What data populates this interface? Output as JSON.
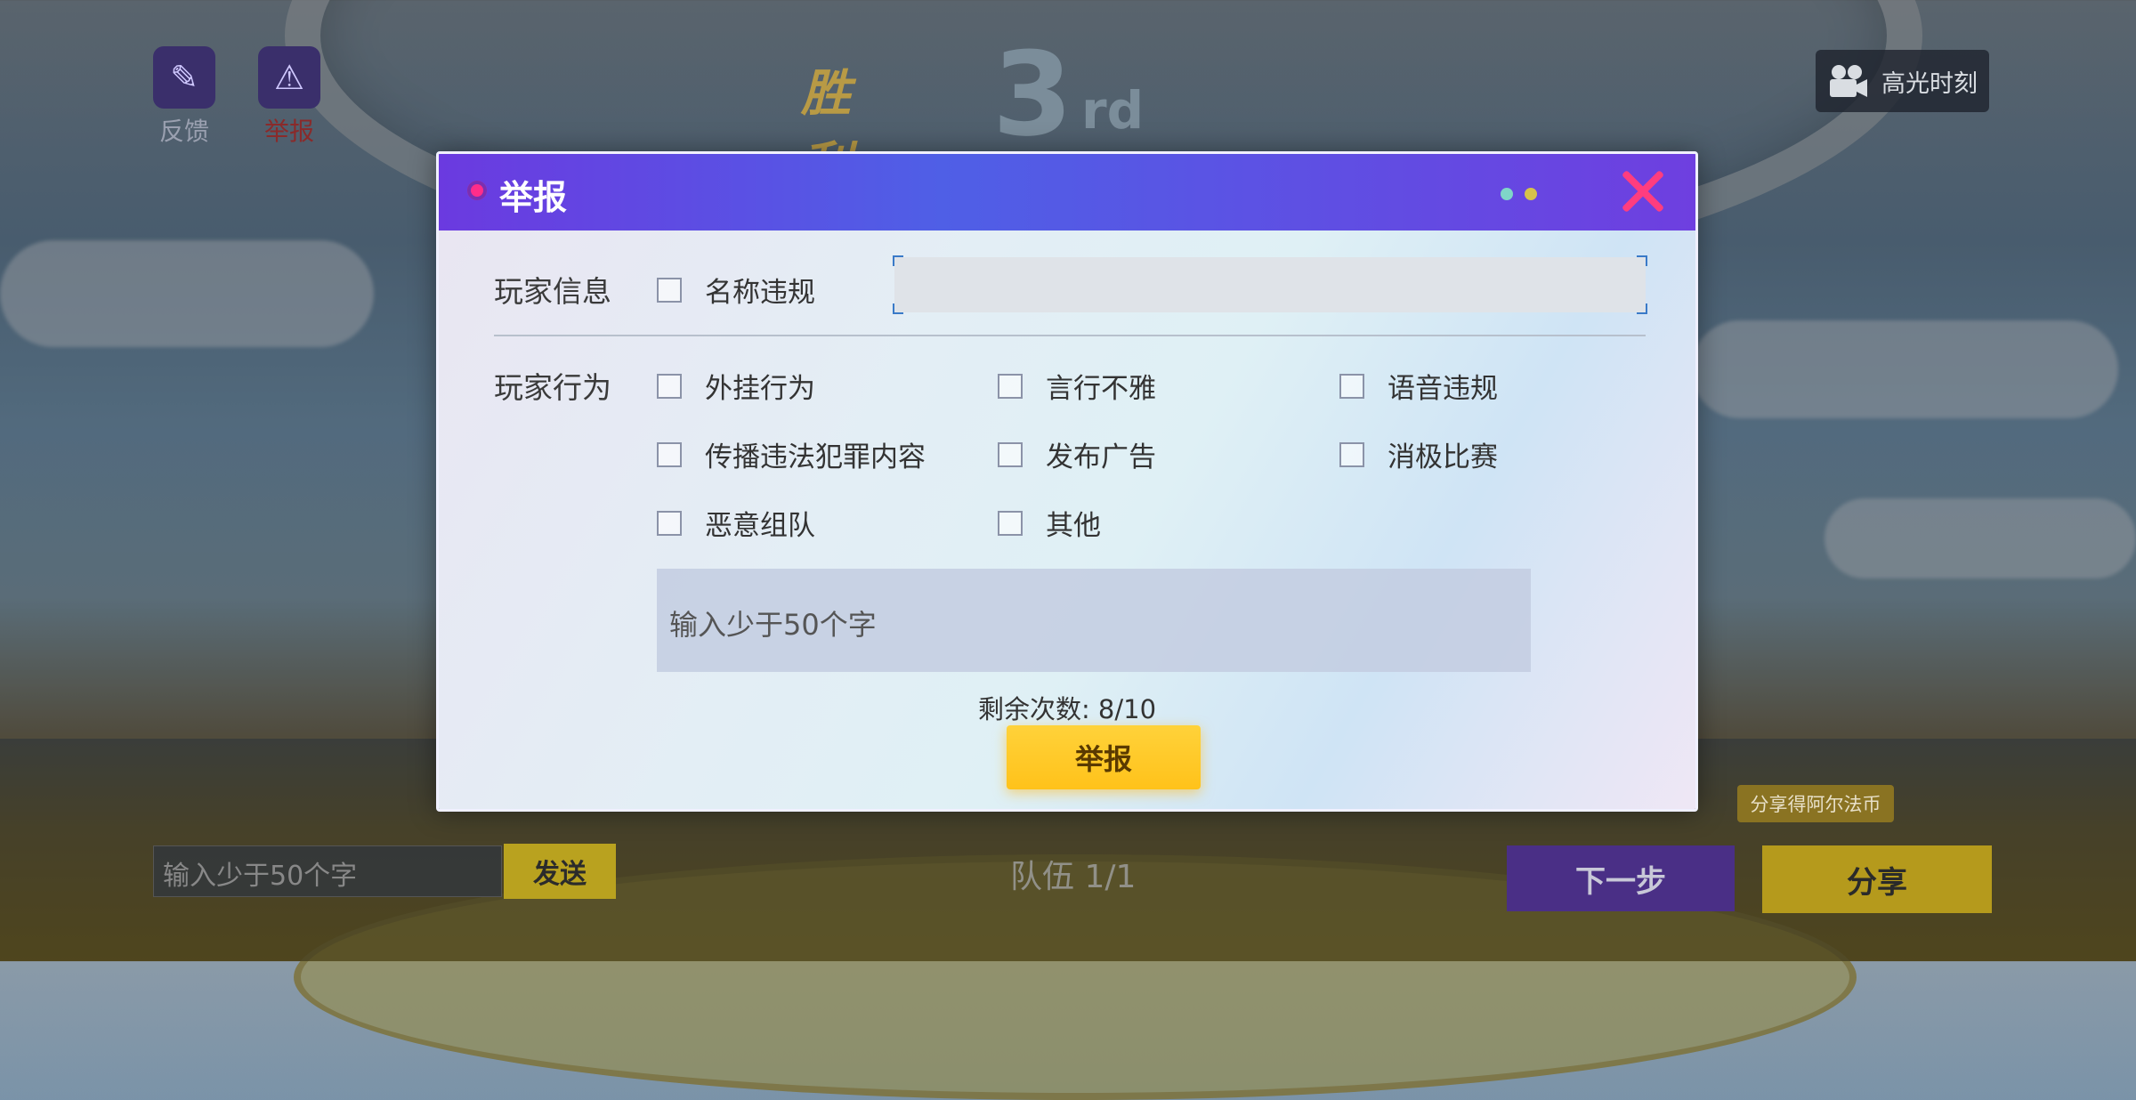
{
  "top_left": {
    "feedback_label": "反馈",
    "report_label": "举报"
  },
  "rank": {
    "win_text": "胜利",
    "position_num": "3",
    "position_suffix": "rd"
  },
  "highlight": {
    "label": "高光时刻"
  },
  "modal": {
    "title": "举报",
    "player_info_label": "玩家信息",
    "name_violation": "名称违规",
    "player_behavior_label": "玩家行为",
    "options": [
      "外挂行为",
      "言行不雅",
      "语音违规",
      "传播违法犯罪内容",
      "发布广告",
      "消极比赛",
      "恶意组队",
      "其他"
    ],
    "description_placeholder": "输入少于50个字",
    "remaining": "剩余次数: 8/10",
    "submit_label": "举报",
    "accent_dot_colors": [
      "#7fd6c8",
      "#d6c24a"
    ]
  },
  "bottom": {
    "chat_placeholder": "输入少于50个字",
    "send_label": "发送",
    "team_count": "队伍 1/1",
    "next_label": "下一步",
    "share_label": "分享",
    "share_tip": "分享得阿尔法币"
  }
}
